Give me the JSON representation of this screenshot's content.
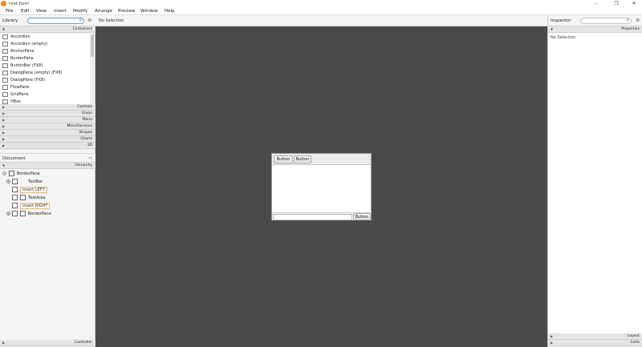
{
  "window": {
    "title": "root.fxml",
    "icon": "scene-builder-app-icon",
    "controls": [
      "–",
      "❐",
      "✕"
    ]
  },
  "menubar": [
    "File",
    "Edit",
    "View",
    "Insert",
    "Modify",
    "Arrange",
    "Preview",
    "Window",
    "Help"
  ],
  "library": {
    "title": "Library",
    "search_placeholder": "",
    "open_section": "Containers",
    "items": [
      "Accordion",
      "Accordion  (empty)",
      "AnchorPane",
      "BorderPane",
      "ButtonBar  (FX8)",
      "DialogPane (empty)  (FX8)",
      "DialogPane  (FX8)",
      "FlowPane",
      "GridPane",
      "HBox"
    ],
    "collapsed_sections": [
      "Controls",
      "Gluon",
      "Menu",
      "Miscellaneous",
      "Shapes",
      "Charts",
      "3D"
    ]
  },
  "document": {
    "title": "Document",
    "section": "Hierarchy",
    "tree": [
      {
        "label": "BorderPane",
        "kind": "node",
        "toggle": "−"
      },
      {
        "label": "ToolBar",
        "kind": "node",
        "toggle": "+"
      },
      {
        "label": "insert LEFT",
        "kind": "insert"
      },
      {
        "label": "TextArea",
        "kind": "node"
      },
      {
        "label": "insert RIGHT",
        "kind": "insert"
      },
      {
        "label": "BorderPane",
        "kind": "node",
        "toggle": "+"
      }
    ],
    "controller_section": "Controller"
  },
  "canvas": {
    "selection_text": "No Selection",
    "background": "#4a4a4a",
    "preview": {
      "toolbar_buttons": [
        "Button",
        "Button"
      ],
      "bottom_button": "Button"
    }
  },
  "inspector": {
    "title": "Inspector",
    "search_placeholder": "",
    "properties_section": "Properties",
    "empty_text": "No Selection",
    "layout_section": "Layout",
    "code_section": "Code"
  },
  "colors": {
    "accent": "#5aa0d8",
    "insert_tag_border": "#e2b57d",
    "app_icon": "#f08a24"
  }
}
